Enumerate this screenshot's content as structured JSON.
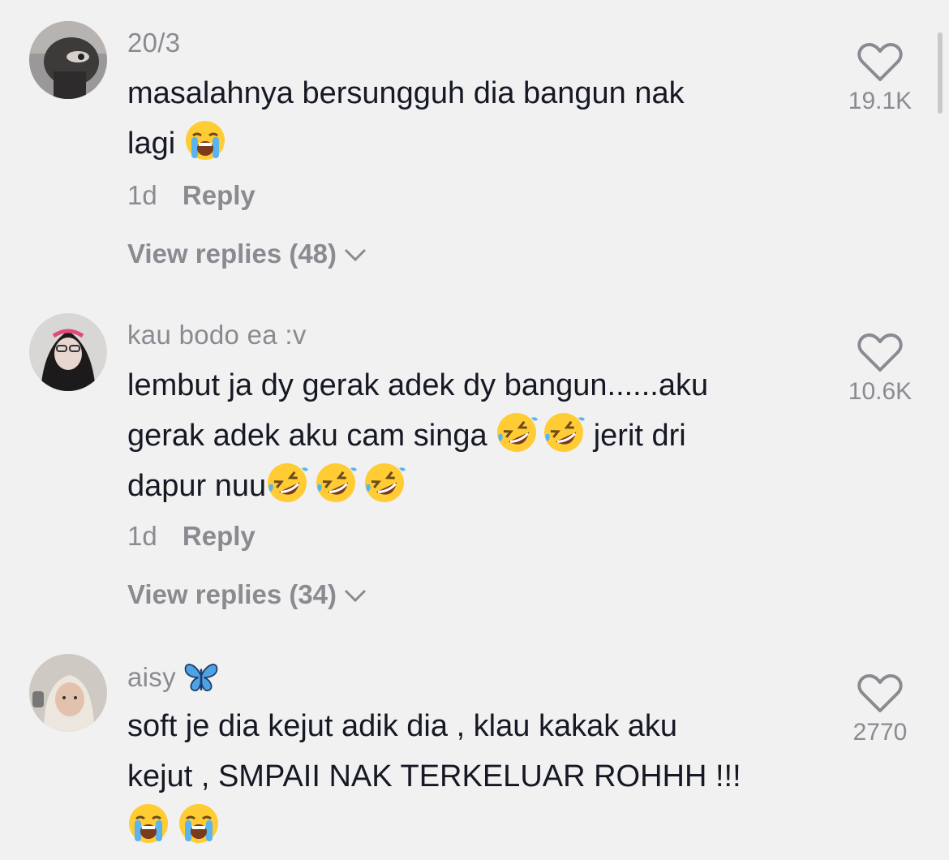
{
  "comments": [
    {
      "username": "20/3",
      "text_parts": [
        "masalahnya bersungguh dia bangun nak",
        "lagi"
      ],
      "time": "1d",
      "reply_label": "Reply",
      "view_replies": "View replies (48)",
      "likes": "19.1K",
      "emoji": [
        "loudly-crying-face"
      ]
    },
    {
      "username": "kau bodo ea :v",
      "text_parts": [
        "lembut ja dy gerak adek dy bangun......aku",
        "gerak adek aku cam singa",
        "jerit dri",
        "dapur nuu"
      ],
      "time": "1d",
      "reply_label": "Reply",
      "view_replies": "View replies (34)",
      "likes": "10.6K",
      "emoji": [
        "rolling-on-floor-laughing"
      ]
    },
    {
      "username": "aisy",
      "text_parts": [
        "soft je dia kejut adik dia , klau kakak aku",
        "kejut , SMPAII NAK TERKELUAR ROHHH !!!"
      ],
      "likes": "2770",
      "emoji": [
        "butterfly",
        "loudly-crying-face"
      ]
    }
  ],
  "colors": {
    "background": "#f1f1f2",
    "text": "#161823",
    "secondary": "#8a8b91"
  }
}
